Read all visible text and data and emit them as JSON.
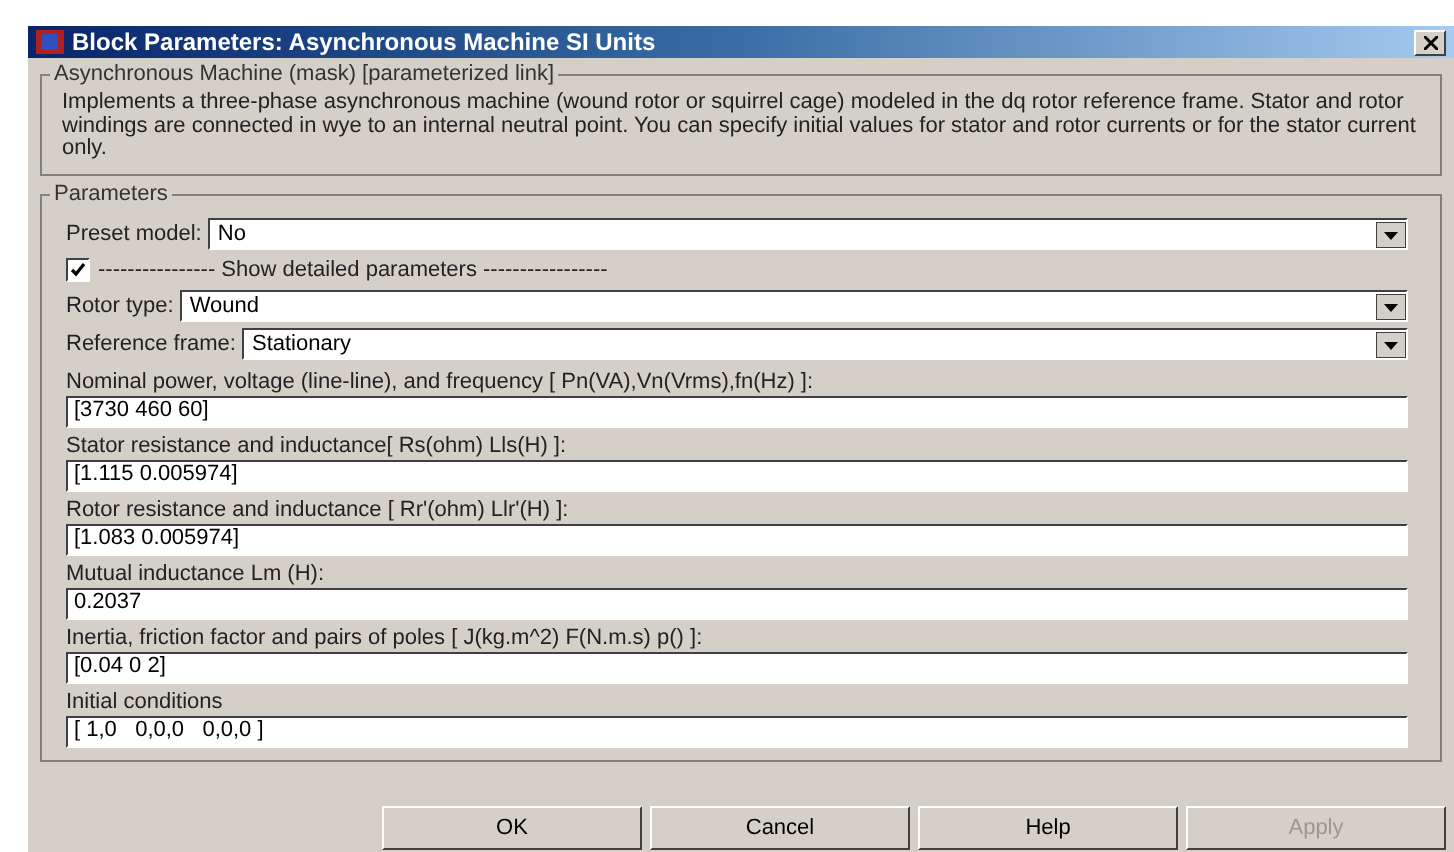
{
  "window": {
    "title": "Block Parameters: Asynchronous Machine SI Units"
  },
  "description_group": {
    "title": "Asynchronous Machine (mask) [parameterized link]",
    "text": "Implements a three-phase asynchronous machine (wound rotor or squirrel cage) modeled in the dq rotor reference frame. Stator and rotor windings are connected in wye to an internal neutral point. You can specify initial values for stator and rotor currents or for  the stator current only."
  },
  "parameters": {
    "title": "Parameters",
    "items": [
      {
        "kind": "dropdown",
        "label": "Preset model:",
        "value": "No"
      },
      {
        "kind": "checkbox",
        "label": "---------------- Show detailed parameters -----------------",
        "checked": true
      },
      {
        "kind": "dropdown",
        "label": "Rotor type:",
        "value": "Wound"
      },
      {
        "kind": "dropdown",
        "label": "Reference frame:",
        "value": "Stationary"
      },
      {
        "kind": "text",
        "label": "Nominal power, voltage (line-line), and frequency [ Pn(VA),Vn(Vrms),fn(Hz) ]:",
        "value": "[3730 460 60]"
      },
      {
        "kind": "text",
        "label": "Stator resistance and inductance[ Rs(ohm)  Lls(H) ]:",
        "value": "[1.115 0.005974]"
      },
      {
        "kind": "text",
        "label": "Rotor resistance and inductance [ Rr'(ohm)  Llr'(H) ]:",
        "value": "[1.083 0.005974]"
      },
      {
        "kind": "text",
        "label": "Mutual inductance Lm (H):",
        "value": "0.2037"
      },
      {
        "kind": "text",
        "label": "Inertia, friction factor and pairs of poles [ J(kg.m^2)  F(N.m.s)  p() ]:",
        "value": "[0.04 0 2]"
      },
      {
        "kind": "text",
        "label": "Initial conditions",
        "value": "[ 1,0   0,0,0   0,0,0 ]"
      }
    ]
  },
  "buttons": [
    {
      "label": "OK",
      "disabled": false
    },
    {
      "label": "Cancel",
      "disabled": false
    },
    {
      "label": "Help",
      "disabled": false
    },
    {
      "label": "Apply",
      "disabled": true
    }
  ]
}
